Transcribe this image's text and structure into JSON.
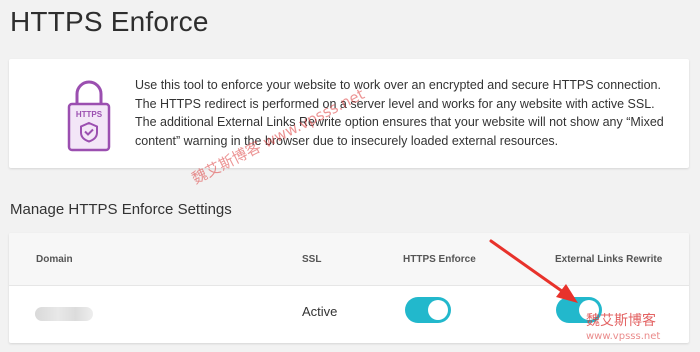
{
  "page": {
    "title": "HTTPS Enforce"
  },
  "info": {
    "icon_label": "HTTPS",
    "lines": [
      "Use this tool to enforce your website to work over an encrypted and secure HTTPS connection.",
      "The HTTPS redirect is performed on a server level and works for any website with active SSL.",
      "The additional External Links Rewrite option ensures that your website will not show any “Mixed",
      "content” warning in the browser due to insecurely loaded external resources."
    ]
  },
  "settings": {
    "heading": "Manage HTTPS Enforce Settings",
    "columns": {
      "domain": "Domain",
      "ssl": "SSL",
      "https_enforce": "HTTPS Enforce",
      "external_links": "External Links Rewrite"
    },
    "rows": [
      {
        "ssl": "Active",
        "https_enforce": true,
        "external_links": true
      }
    ]
  },
  "watermark": {
    "diagonal": "魏艾斯博客 www.vpsss.net",
    "corner": "魏艾斯博客",
    "corner_sub": "www.vpsss.net"
  },
  "colors": {
    "accent": "#22b8cc",
    "lock_purple": "#9b4fb0",
    "arrow_red": "#e8322b"
  },
  "icons": {
    "lock": "lock-icon",
    "arrow": "red-arrow-annotation"
  }
}
